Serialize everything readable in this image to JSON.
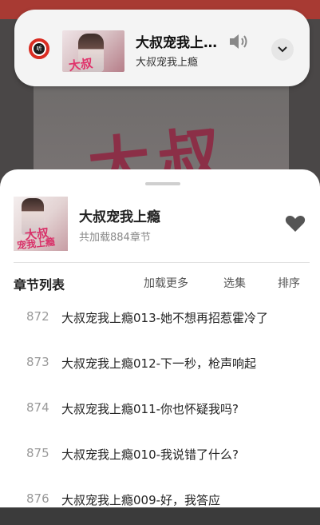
{
  "mini_player": {
    "title": "大叔宠我上…",
    "subtitle": "大叔宠我上瘾",
    "logo_text": "听",
    "cover_text": "大叔",
    "icons": [
      "app-logo-icon",
      "speaker-icon",
      "chevron-down-icon"
    ]
  },
  "background": {
    "cover_text": "大叔"
  },
  "book": {
    "title": "大叔宠我上瘾",
    "count": "共加载884章节",
    "cover_text_1": "大叔",
    "cover_text_2": "宠我上瘾"
  },
  "chapter_section": {
    "header": "章节列表",
    "load_more": "加载更多",
    "select": "选集",
    "sort": "排序"
  },
  "chapters": [
    {
      "num": "872",
      "title": "大叔宠我上瘾013-她不想再招惹霍冷了"
    },
    {
      "num": "873",
      "title": "大叔宠我上瘾012-下一秒，枪声响起"
    },
    {
      "num": "874",
      "title": "大叔宠我上瘾011-你也怀疑我吗?"
    },
    {
      "num": "875",
      "title": "大叔宠我上瘾010-我说错了什么?"
    },
    {
      "num": "876",
      "title": "大叔宠我上瘾009-好，我答应"
    }
  ],
  "colors": {
    "accent_red": "#d92c22",
    "cover_pink": "#e0326a",
    "heart": "#555555"
  }
}
